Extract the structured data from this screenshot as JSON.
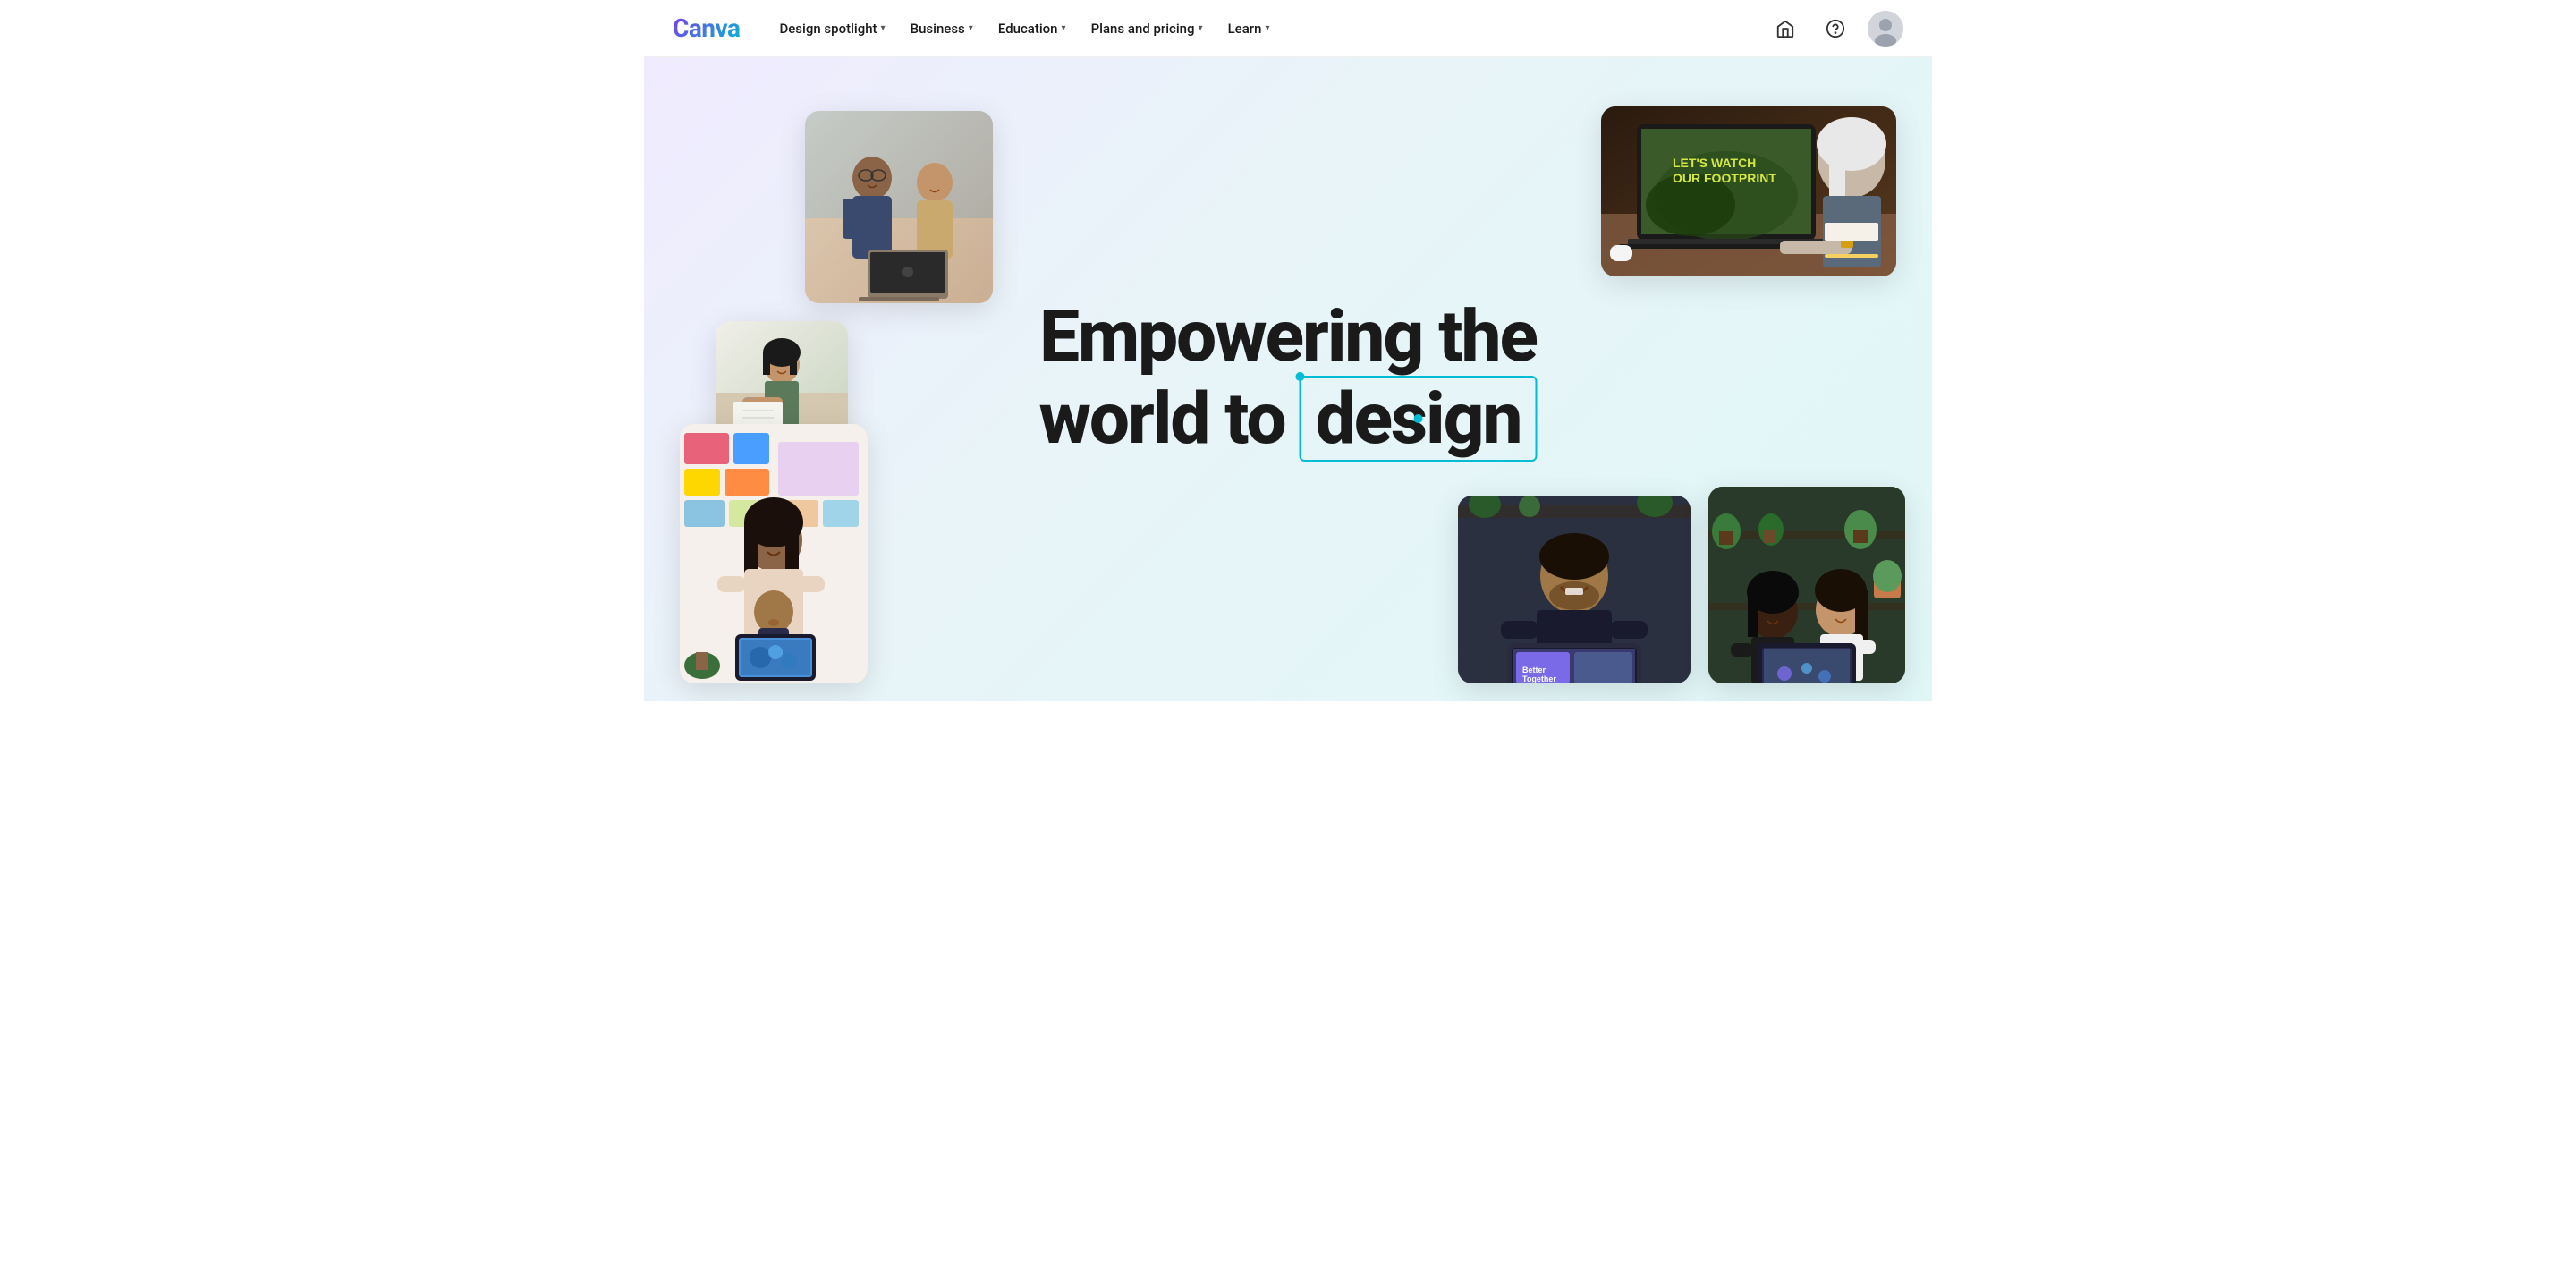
{
  "brand": {
    "name": "Canva"
  },
  "nav": {
    "links": [
      {
        "id": "design-spotlight",
        "label": "Design spotlight",
        "hasDropdown": true
      },
      {
        "id": "business",
        "label": "Business",
        "hasDropdown": true
      },
      {
        "id": "education",
        "label": "Education",
        "hasDropdown": true
      },
      {
        "id": "plans-pricing",
        "label": "Plans and pricing",
        "hasDropdown": true
      },
      {
        "id": "learn",
        "label": "Learn",
        "hasDropdown": true
      }
    ],
    "icons": {
      "home": "🏠",
      "help": "?",
      "chevron": "▾"
    }
  },
  "hero": {
    "line1": "Empowering the",
    "line2_prefix": "world to",
    "line2_highlight": "design",
    "photos": [
      {
        "id": "top-left",
        "alt": "Two people collaborating on laptop"
      },
      {
        "id": "mid-left",
        "alt": "Woman writing at desk"
      },
      {
        "id": "bottom-left",
        "alt": "Mother and child with tablet"
      },
      {
        "id": "top-right",
        "alt": "Person working on laptop presentation"
      },
      {
        "id": "bottom-right",
        "alt": "Two women looking at laptop with plants"
      },
      {
        "id": "bottom-center",
        "alt": "Smiling man with laptop"
      }
    ]
  }
}
